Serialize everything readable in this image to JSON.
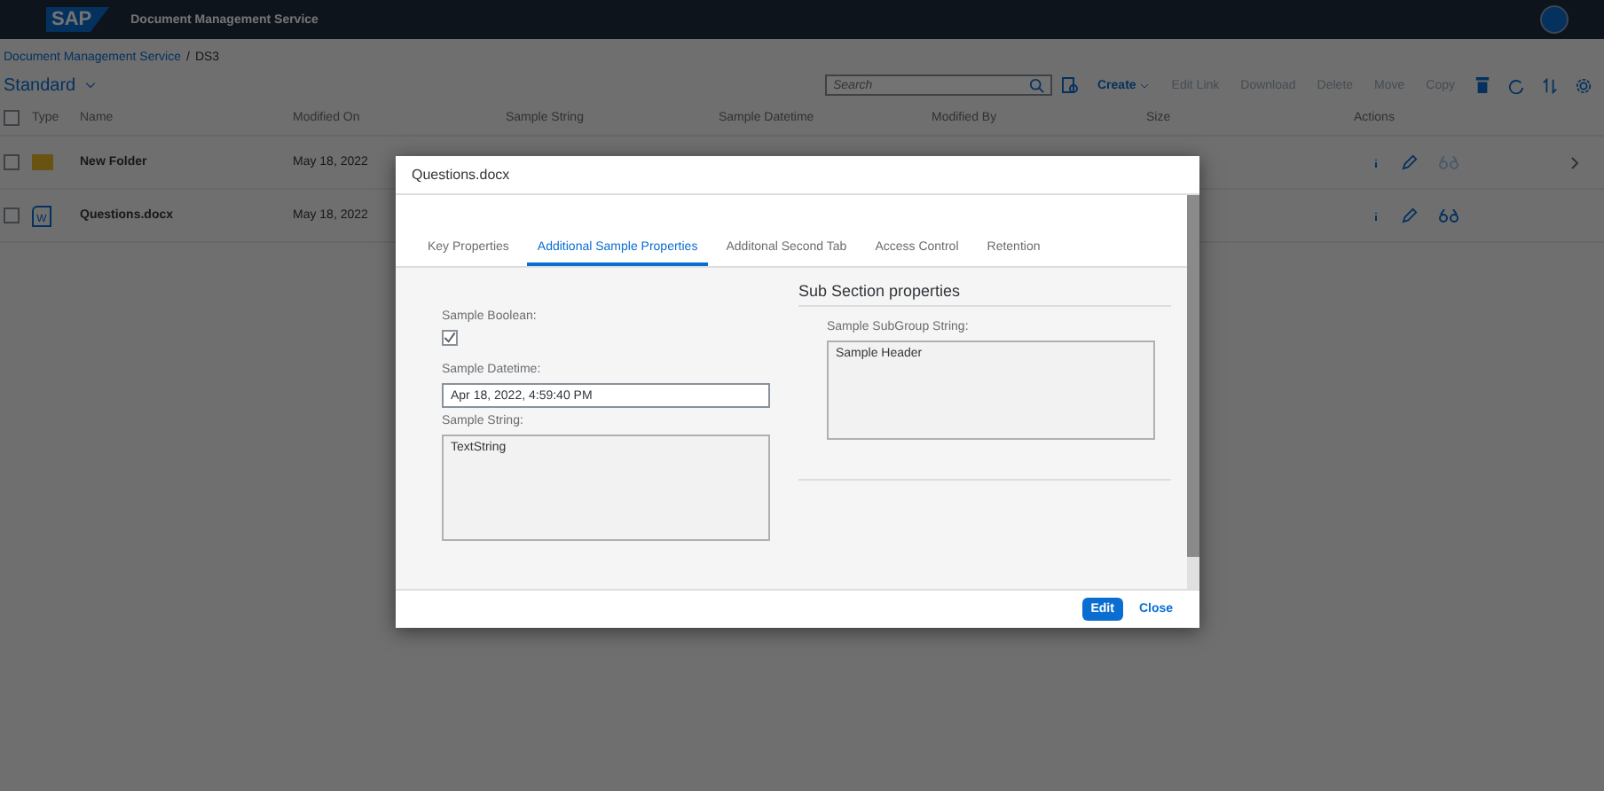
{
  "shell": {
    "logo": "SAP",
    "title": "Document Management Service"
  },
  "breadcrumb": {
    "links": [
      "Document Management Service"
    ],
    "separator": "/",
    "current": "DS3"
  },
  "variant": {
    "label": "Standard"
  },
  "toolbar": {
    "search": {
      "placeholder": "Search"
    },
    "buttons": [
      {
        "label": "Create",
        "disabled": false,
        "menu": true
      },
      {
        "label": "Edit Link",
        "disabled": true,
        "menu": false
      },
      {
        "label": "Download",
        "disabled": true,
        "menu": false
      },
      {
        "label": "Delete",
        "disabled": true,
        "menu": false
      },
      {
        "label": "Move",
        "disabled": true,
        "menu": false
      },
      {
        "label": "Copy",
        "disabled": true,
        "menu": false
      }
    ]
  },
  "table": {
    "select_all": false,
    "columns": [
      "Type",
      "Name",
      "Modified On",
      "Sample String",
      "Sample Datetime",
      "Modified By",
      "Size",
      "Actions"
    ],
    "rows": [
      {
        "kind": "folder",
        "checked": false,
        "name": "New Folder",
        "modified_on": "May 18, 2022",
        "preview_enabled": false,
        "navigable": true
      },
      {
        "kind": "document",
        "type_label": "W",
        "checked": false,
        "name": "Questions.docx",
        "modified_on": "May 18, 2022",
        "preview_enabled": true,
        "navigable": false
      }
    ]
  },
  "dialog": {
    "title": "Questions.docx",
    "tabs": [
      {
        "label": "Key Properties",
        "selected": false
      },
      {
        "label": "Additional Sample Properties",
        "selected": true
      },
      {
        "label": "Additonal Second Tab",
        "selected": false
      },
      {
        "label": "Access Control",
        "selected": false
      },
      {
        "label": "Retention",
        "selected": false
      }
    ],
    "fields": [
      {
        "kind": "checkbox",
        "label": "Sample Boolean:",
        "checked": true
      },
      {
        "kind": "input",
        "label": "Sample Datetime:",
        "value": "Apr 18, 2022, 4:59:40 PM"
      },
      {
        "kind": "textarea",
        "label": "Sample String:",
        "value": "TextString"
      }
    ],
    "sub_section": {
      "title": "Sub Section properties",
      "fields": [
        {
          "kind": "textarea",
          "label": "Sample SubGroup String:",
          "value": "Sample Header"
        }
      ]
    },
    "buttons": [
      {
        "label": "Edit",
        "kind": "emphasized"
      },
      {
        "label": "Close",
        "kind": "transparent"
      }
    ]
  }
}
